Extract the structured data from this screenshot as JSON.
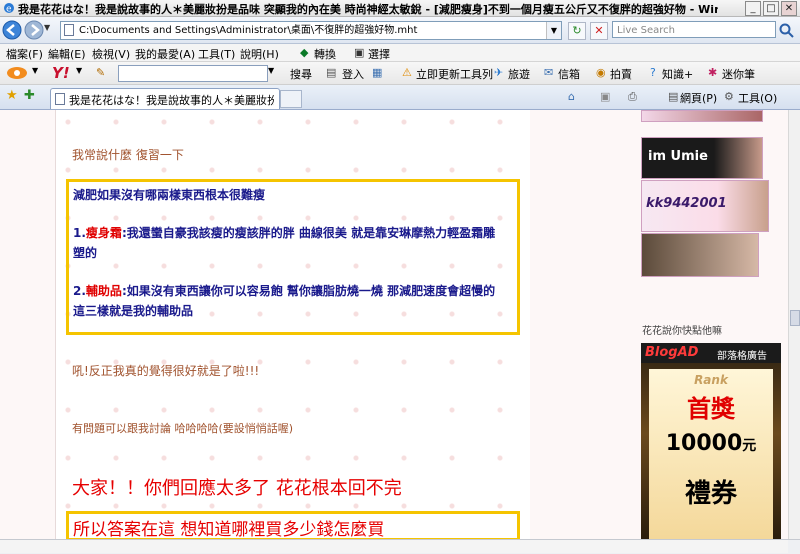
{
  "window": {
    "title": "我是花花はな！我是說故事的人＊美麗妝扮是品味 突顯我的內在美 時尚神經太敏銳 - [減肥瘦身]不到一個月瘦五公斤又不復胖的超強好物 - Windows Internet E...",
    "minimize": "_",
    "maximize": "□",
    "close": "✕"
  },
  "address_bar": {
    "url": "C:\\Documents and Settings\\Administrator\\桌面\\不復胖的超強好物.mht",
    "refresh": "↻",
    "stop": "✕",
    "search_placeholder": "Live Search"
  },
  "menu": {
    "items": [
      "檔案(F)",
      "編輯(E)",
      "檢視(V)",
      "我的最愛(A)",
      "工具(T)",
      "說明(H)"
    ],
    "convert": "轉換",
    "select": "選擇"
  },
  "yahoo_toolbar": {
    "search": "搜尋",
    "login": "登入",
    "update": "立即更新工具列",
    "travel": "旅遊",
    "mail": "信箱",
    "auction": "拍賣",
    "knowledge": "知識+",
    "mini": "迷你筆"
  },
  "tabs": {
    "active": "我是花花はな！我是說故事的人＊美麗妝扮是品...",
    "page": "網頁(P)",
    "tools": "工具(O)"
  },
  "post": {
    "line1": "我常說什麼 復習一下",
    "box_title": "減肥如果沒有哪兩樣東西根本很難瘦",
    "item1_prefix": "1.",
    "item1_label": "瘦身霜",
    "item1_text_a": ":我還蠻自豪我該瘦的瘦該胖的胖 曲線很美 就是靠安琳摩熱力輕盈霜雕",
    "item1_text_b": "塑的",
    "item2_prefix": "2.",
    "item2_label": "輔助品",
    "item2_text_a": ":如果沒有東西讓你可以容易飽 幫你讓脂肪燒一燒 那減肥速度會超慢的",
    "item2_text_b": "這三樣就是我的輔助品",
    "line_after": "吼!反正我真的覺得很好就是了啦!!!",
    "discuss": "有問題可以跟我討論  哈哈哈哈(要設悄悄話喔)",
    "big1": "大家！！你們回應太多了       花花根本回不完",
    "big2": "所以答案在這  想知道哪裡買多少錢怎麼買"
  },
  "sidebar": {
    "banner1_text": "im Umie",
    "banner2_text": "kk9442001",
    "tagline": "花花說你快點他嘛",
    "blogad_logo": "BlogAD",
    "blogad_sub": "部落格廣告",
    "ad_rank": "Rank",
    "ad_top": "首獎",
    "ad_amount": "10000",
    "ad_unit": "元",
    "ad_coupon": "禮券"
  }
}
